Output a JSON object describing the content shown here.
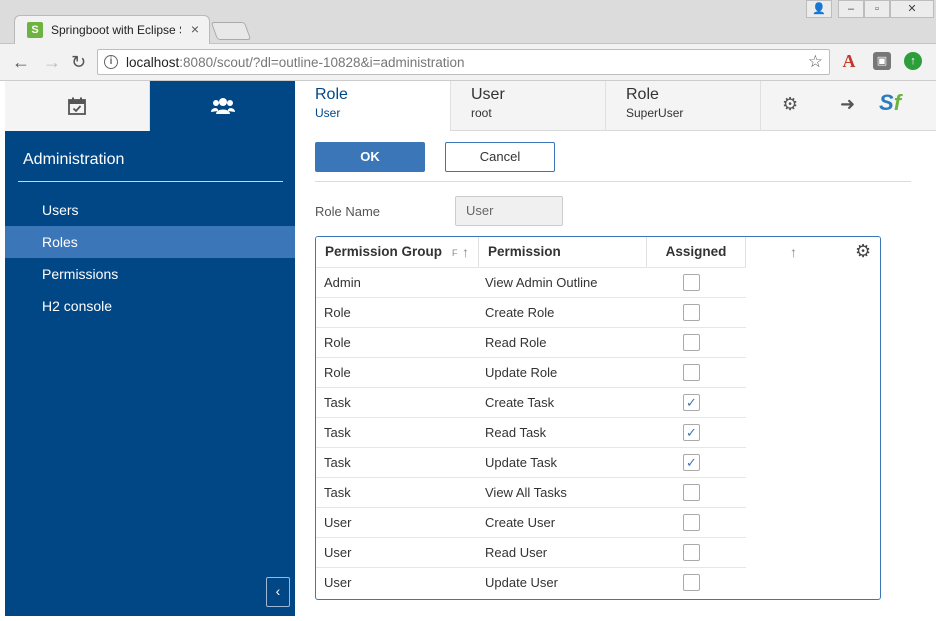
{
  "browser": {
    "tab_title": "Springboot with Eclipse Scout",
    "tab_favicon": "S",
    "url_host": "localhost",
    "url_rest": ":8080/scout/?dl=outline-10828&i=administration",
    "new_tab_icon": "new-tab-icon",
    "extensions": [
      "pdf-extension",
      "gray-extension",
      "green-extension"
    ]
  },
  "sidebar": {
    "title": "Administration",
    "items": [
      {
        "label": "Users",
        "selected": false
      },
      {
        "label": "Roles",
        "selected": true
      },
      {
        "label": "Permissions",
        "selected": false
      },
      {
        "label": "H2 console",
        "selected": false
      }
    ],
    "top_tabs": [
      "calendar-icon",
      "users-icon"
    ]
  },
  "view_tabs": [
    {
      "title": "Role",
      "subtitle": "User",
      "active": true
    },
    {
      "title": "User",
      "subtitle": "root",
      "active": false
    },
    {
      "title": "Role",
      "subtitle": "SuperUser",
      "active": false
    }
  ],
  "toolbar": {
    "ok_label": "OK",
    "cancel_label": "Cancel"
  },
  "form": {
    "role_name_label": "Role Name",
    "role_name_value": "User"
  },
  "table": {
    "columns": [
      "Permission Group",
      "Permission",
      "Assigned"
    ],
    "sort_marker": "F",
    "rows": [
      {
        "group": "Admin",
        "permission": "View Admin Outline",
        "assigned": false
      },
      {
        "group": "Role",
        "permission": "Create Role",
        "assigned": false
      },
      {
        "group": "Role",
        "permission": "Read Role",
        "assigned": false
      },
      {
        "group": "Role",
        "permission": "Update Role",
        "assigned": false
      },
      {
        "group": "Task",
        "permission": "Create Task",
        "assigned": true
      },
      {
        "group": "Task",
        "permission": "Read Task",
        "assigned": true
      },
      {
        "group": "Task",
        "permission": "Update Task",
        "assigned": true
      },
      {
        "group": "Task",
        "permission": "View All Tasks",
        "assigned": false
      },
      {
        "group": "User",
        "permission": "Create User",
        "assigned": false
      },
      {
        "group": "User",
        "permission": "Read User",
        "assigned": false
      },
      {
        "group": "User",
        "permission": "Update User",
        "assigned": false
      }
    ]
  },
  "colors": {
    "sidebar_bg": "#014786",
    "accent": "#3b77b8"
  }
}
